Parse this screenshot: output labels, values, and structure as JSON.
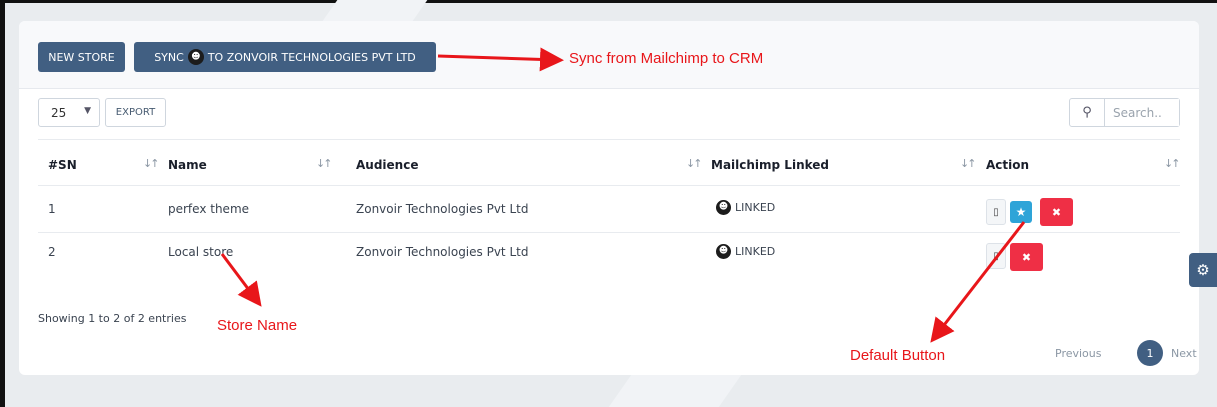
{
  "toolbar": {
    "new_store_label": "NEW STORE",
    "sync_label_prefix": "SYNC",
    "sync_label_suffix": "TO ZONVOIR TECHNOLOGIES PVT LTD",
    "sync_icon": "mailchimp-logo-icon"
  },
  "controls": {
    "page_length": "25",
    "export_label": "EXPORT",
    "search_placeholder": "Search.."
  },
  "table": {
    "columns": [
      "#SN",
      "Name",
      "Audience",
      "Mailchimp Linked",
      "Action"
    ],
    "rows": [
      {
        "sn": "1",
        "name": "perfex theme",
        "audience": "Zonvoir Technologies Pvt Ltd",
        "linked": "LINKED"
      },
      {
        "sn": "2",
        "name": "Local store",
        "audience": "Zonvoir Technologies Pvt Ltd",
        "linked": "LINKED"
      }
    ]
  },
  "footer": {
    "showing": "Showing 1 to 2 of 2 entries",
    "prev": "Previous",
    "current_page": "1",
    "next": "Next"
  },
  "annotations": {
    "sync": "Sync from Mailchimp to CRM",
    "store_name": "Store Name",
    "default_button": "Default Button"
  },
  "colors": {
    "primary": "#415f82",
    "info": "#2ea4d8",
    "danger": "#ef2f45",
    "annotation": "#e8161a"
  }
}
